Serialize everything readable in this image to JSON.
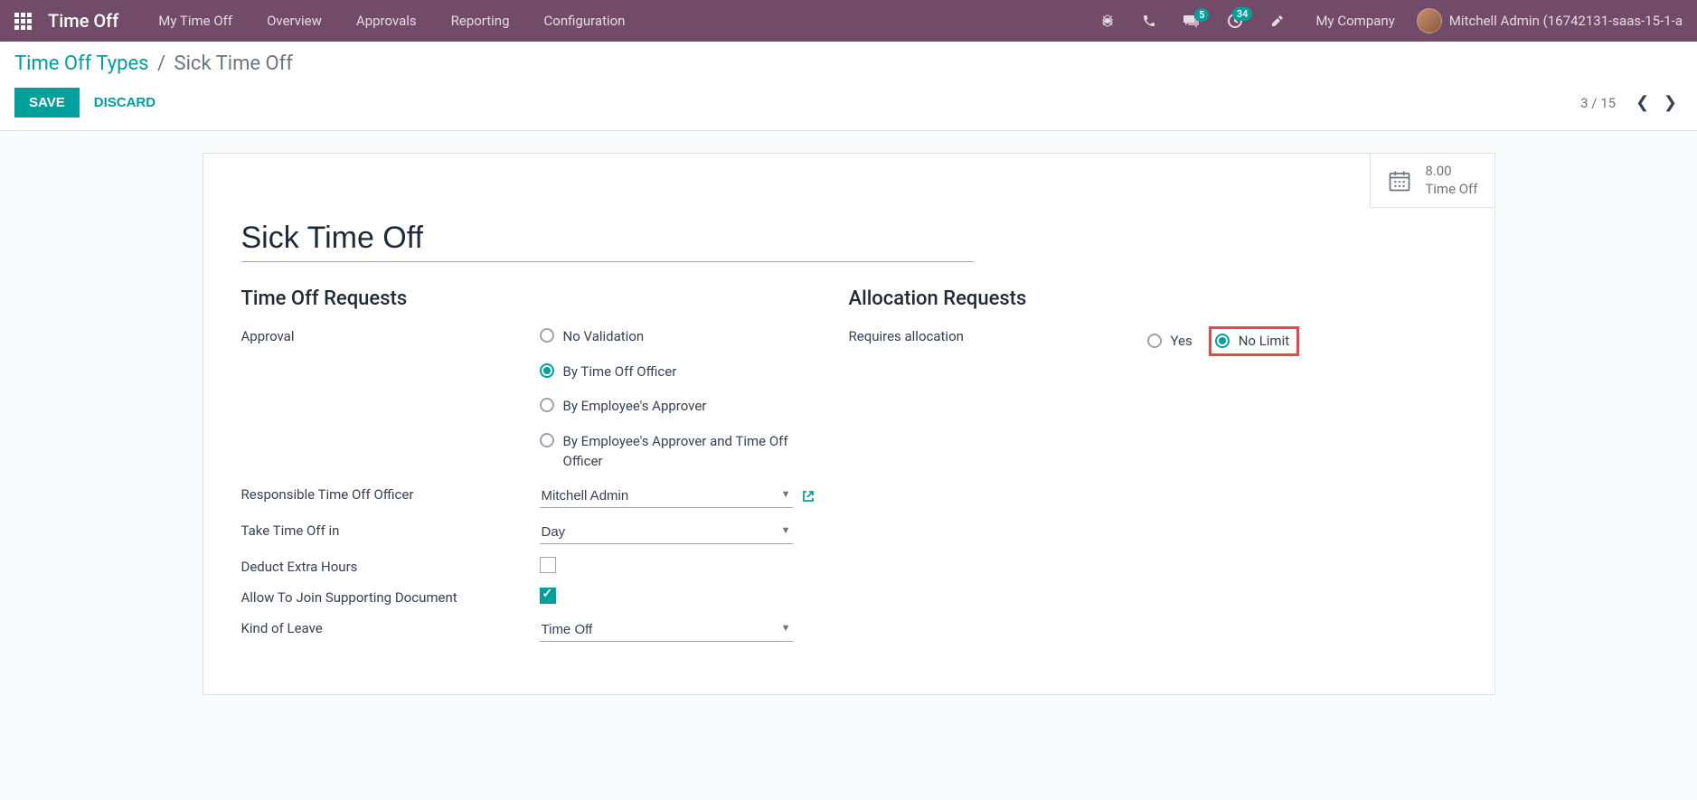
{
  "navbar": {
    "brand": "Time Off",
    "links": [
      "My Time Off",
      "Overview",
      "Approvals",
      "Reporting",
      "Configuration"
    ],
    "messages_badge": "5",
    "activities_badge": "34",
    "company": "My Company",
    "user": "Mitchell Admin (16742131-saas-15-1-a"
  },
  "breadcrumb": {
    "parent": "Time Off Types",
    "current": "Sick Time Off"
  },
  "buttons": {
    "save": "SAVE",
    "discard": "DISCARD"
  },
  "pager": "3 / 15",
  "stat": {
    "value": "8.00",
    "label": "Time Off"
  },
  "form": {
    "title": "Sick Time Off",
    "sections": {
      "left_title": "Time Off Requests",
      "right_title": "Allocation Requests"
    },
    "labels": {
      "approval": "Approval",
      "responsible": "Responsible Time Off Officer",
      "take_in": "Take Time Off in",
      "deduct": "Deduct Extra Hours",
      "supporting": "Allow To Join Supporting Document",
      "kind": "Kind of Leave",
      "requires_alloc": "Requires allocation"
    },
    "approval_options": [
      "No Validation",
      "By Time Off Officer",
      "By Employee's Approver",
      "By Employee's Approver and Time Off Officer"
    ],
    "approval_selected": 1,
    "responsible_value": "Mitchell Admin",
    "take_in_value": "Day",
    "kind_value": "Time Off",
    "alloc_options": [
      "Yes",
      "No Limit"
    ],
    "alloc_selected": 1
  }
}
